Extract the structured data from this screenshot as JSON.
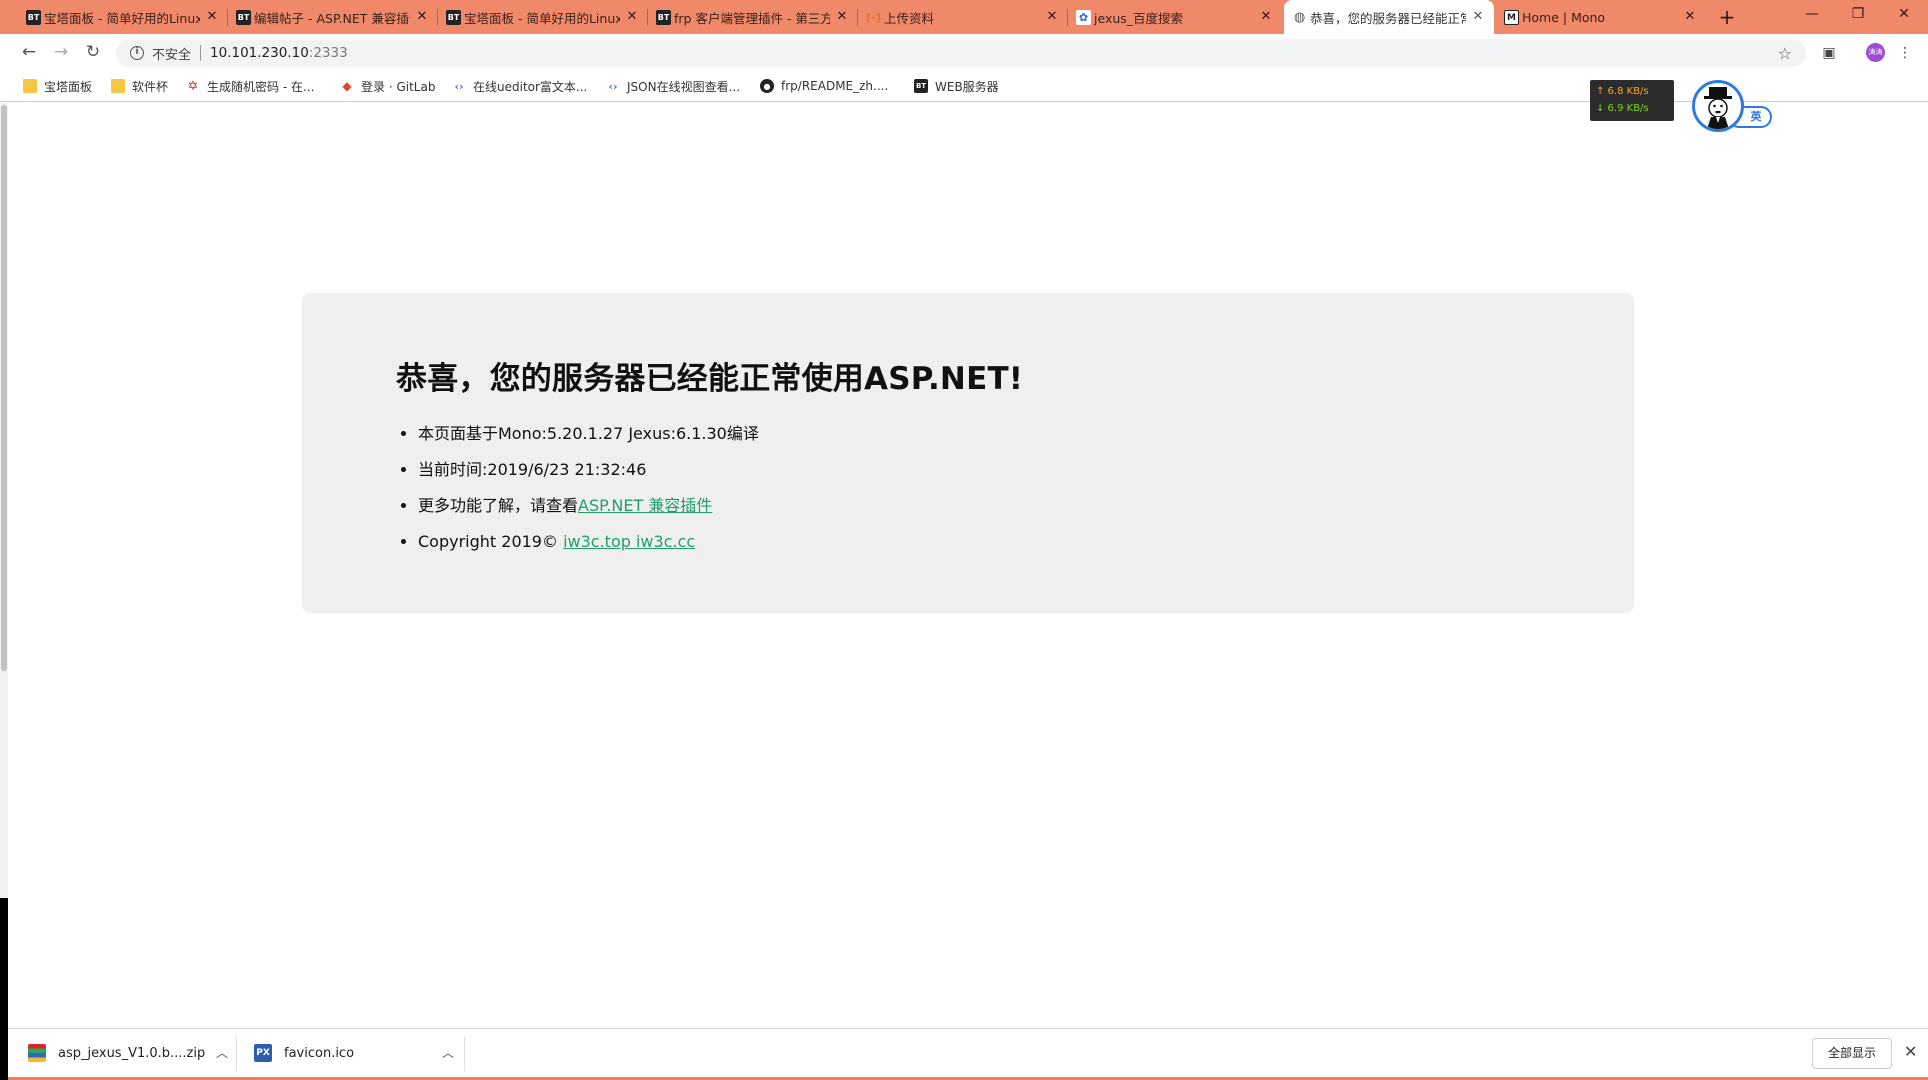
{
  "tabs": [
    {
      "label": "宝塔面板 - 简单好用的Linux",
      "icon": "BT"
    },
    {
      "label": "编辑帖子 - ASP.NET 兼容插件",
      "icon": "BT"
    },
    {
      "label": "宝塔面板 - 简单好用的Linux",
      "icon": "BT"
    },
    {
      "label": "frp 客户端管理插件 - 第三方",
      "icon": "BT"
    },
    {
      "label": "上传资料",
      "icon": "code-bracket"
    },
    {
      "label": "jexus_百度搜索",
      "icon": "paw"
    },
    {
      "label": "恭喜，您的服务器已经能正常",
      "icon": "globe"
    },
    {
      "label": "Home | Mono",
      "icon": "mono"
    }
  ],
  "window": {
    "new_tab": "+",
    "minimize": "—",
    "restore": "❐",
    "close": "✕"
  },
  "toolbar": {
    "security_label": "不安全",
    "url_host": "10.101.230.10",
    "url_port": ":2333",
    "profile_initials": "涛涛"
  },
  "bookmarks": [
    {
      "label": "宝塔面板",
      "icon": "folder"
    },
    {
      "label": "软件杯",
      "icon": "folder"
    },
    {
      "label": "生成随机密码 - 在...",
      "icon": "star6"
    },
    {
      "label": "登录 · GitLab",
      "icon": "gitlab"
    },
    {
      "label": "在线ueditor富文本...",
      "icon": "code"
    },
    {
      "label": "JSON在线视图查看...",
      "icon": "code"
    },
    {
      "label": "frp/README_zh....",
      "icon": "github"
    },
    {
      "label": "WEB服务器",
      "icon": "BT"
    }
  ],
  "speed_widget": {
    "up": "↑ 6.8 KB/s",
    "down": "↓ 6.9 KB/s"
  },
  "avatar_badge": "英",
  "page": {
    "heading": "恭喜，您的服务器已经能正常使用ASP.NET!",
    "item1": "本页面基于Mono:5.20.1.27 Jexus:6.1.30编译",
    "item2": "当前时间:2019/6/23 21:32:46",
    "item3_prefix": "更多功能了解，请查看",
    "item3_link": "ASP.NET 兼容插件",
    "item4_prefix": "Copyright 2019© ",
    "item4_link": "iw3c.top iw3c.cc"
  },
  "downloads": {
    "items": [
      {
        "name": "asp_jexus_V1.0.b....zip"
      },
      {
        "name": "favicon.ico"
      }
    ],
    "show_all": "全部显示"
  },
  "colors": {
    "tab_strip": "#f0896a",
    "link": "#22a06b",
    "card_bg": "#efefef",
    "avatar_ring": "#2d7be0"
  }
}
